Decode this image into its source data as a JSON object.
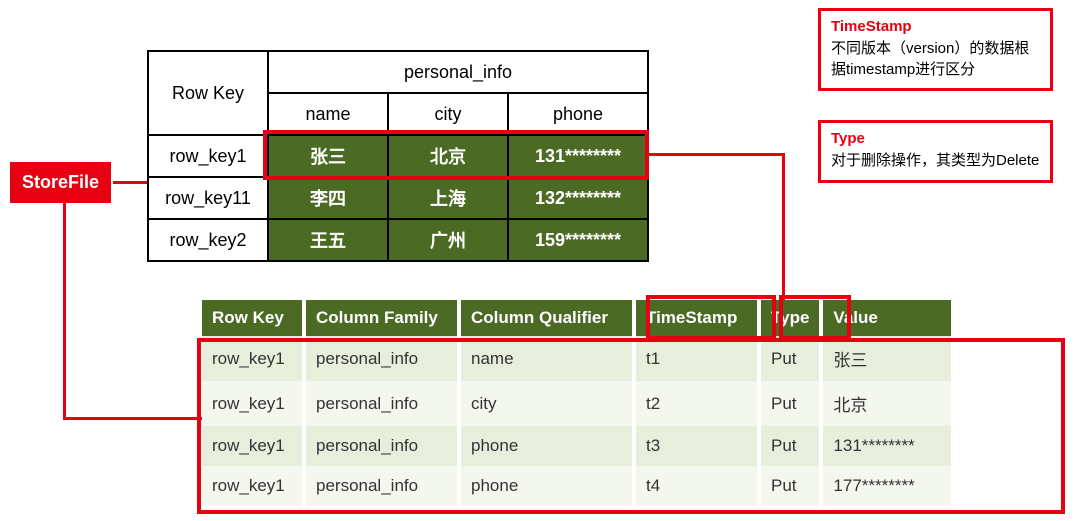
{
  "badge": {
    "storefile": "StoreFile"
  },
  "top_table": {
    "cf_header": "personal_info",
    "rowkey_header": "Row Key",
    "cols": {
      "name": "name",
      "city": "city",
      "phone": "phone"
    },
    "rows": [
      {
        "rk": "row_key1",
        "name": "张三",
        "city": "北京",
        "phone": "131********"
      },
      {
        "rk": "row_key11",
        "name": "李四",
        "city": "上海",
        "phone": "132********"
      },
      {
        "rk": "row_key2",
        "name": "王五",
        "city": "广州",
        "phone": "159********"
      }
    ]
  },
  "callouts": {
    "timestamp": {
      "title": "TimeStamp",
      "body": "不同版本（version）的数据根据timestamp进行区分"
    },
    "type": {
      "title": "Type",
      "body": "对于删除操作，其类型为Delete"
    }
  },
  "detail_table": {
    "headers": {
      "rk": "Row Key",
      "cf": "Column Family",
      "cq": "Column Qualifier",
      "ts": "TimeStamp",
      "type": "Type",
      "val": "Value"
    },
    "rows": [
      {
        "rk": "row_key1",
        "cf": "personal_info",
        "cq": "name",
        "ts": "t1",
        "type": "Put",
        "val": "张三"
      },
      {
        "rk": "row_key1",
        "cf": "personal_info",
        "cq": "city",
        "ts": "t2",
        "type": "Put",
        "val": "北京"
      },
      {
        "rk": "row_key1",
        "cf": "personal_info",
        "cq": "phone",
        "ts": "t3",
        "type": "Put",
        "val": "131********"
      },
      {
        "rk": "row_key1",
        "cf": "personal_info",
        "cq": "phone",
        "ts": "t4",
        "type": "Put",
        "val": "177********"
      }
    ]
  }
}
